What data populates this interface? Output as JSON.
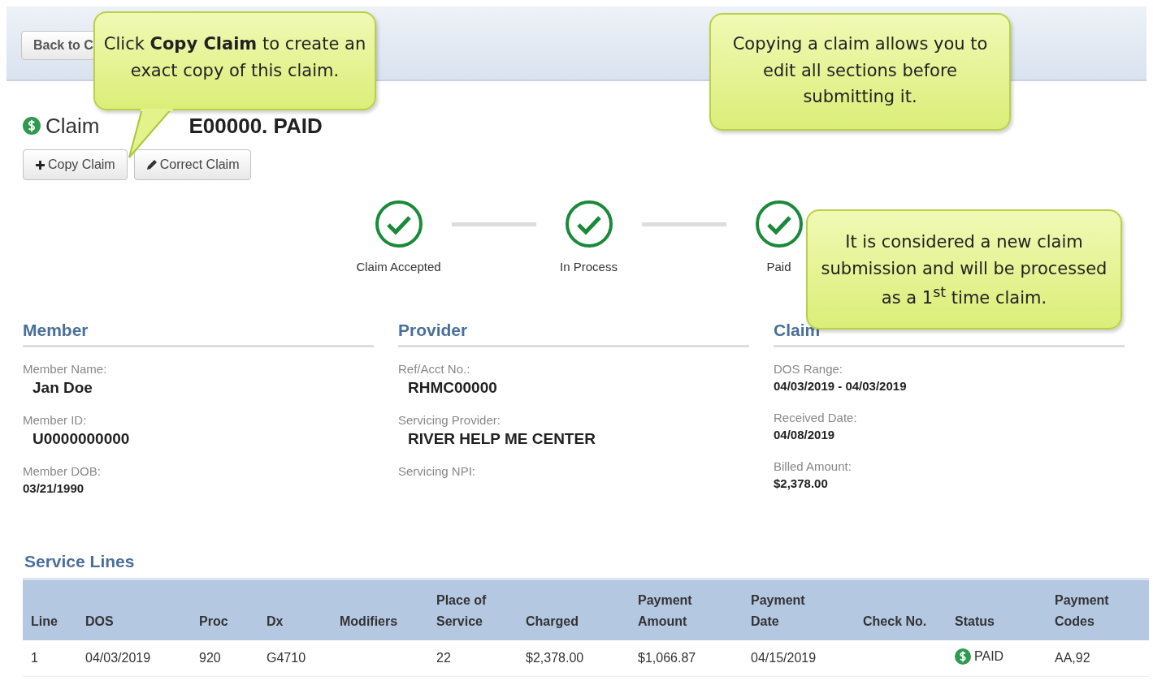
{
  "back_button": {
    "label": "Back to C"
  },
  "claim_title": {
    "word": "Claim",
    "number_end": "E00000. PAID"
  },
  "actions": [
    {
      "kind": "copy",
      "label": "Copy Claim"
    },
    {
      "kind": "correct",
      "label": "Correct Claim"
    }
  ],
  "progress_steps": [
    {
      "label": "Claim Accepted",
      "done": true
    },
    {
      "label": "In Process",
      "done": true
    },
    {
      "label": "Paid",
      "done": true
    }
  ],
  "sections": [
    {
      "title": "Member",
      "fields": [
        {
          "label": "Member Name:",
          "value": "Jan Doe",
          "emphasis": true
        },
        {
          "label": "Member ID:",
          "value": "U0000000000",
          "emphasis": true
        },
        {
          "label": "Member DOB:",
          "value": "03/21/1990",
          "emphasis": false
        }
      ]
    },
    {
      "title": "Provider",
      "fields": [
        {
          "label": "Ref/Acct No.:",
          "value": "RHMC00000",
          "emphasis": true
        },
        {
          "label": "Servicing Provider:",
          "value": "RIVER HELP ME CENTER",
          "emphasis": true
        },
        {
          "label": "Servicing NPI:"
        }
      ]
    },
    {
      "title": "Claim",
      "fields": [
        {
          "label": "DOS Range:",
          "value": "04/03/2019 - 04/03/2019",
          "emphasis": false
        },
        {
          "label": "Received Date:",
          "value": "04/08/2019",
          "emphasis": false
        },
        {
          "label": "Billed Amount:",
          "value": "$2,378.00",
          "emphasis": false
        }
      ]
    }
  ],
  "service_lines": {
    "title": "Service Lines",
    "columns": [
      {
        "heading": "Line"
      },
      {
        "heading": "DOS"
      },
      {
        "heading": "Proc"
      },
      {
        "heading": "Dx"
      },
      {
        "heading": "Modifiers"
      },
      {
        "heading": "Place of Service"
      },
      {
        "heading": "Charged"
      },
      {
        "heading": "Payment Amount"
      },
      {
        "heading": "Payment Date"
      },
      {
        "heading": "Check No."
      },
      {
        "heading": "Status"
      },
      {
        "heading": "Payment Codes"
      }
    ],
    "rows": [
      {
        "cells": [
          "1",
          "04/03/2019",
          "920",
          "G4710",
          null,
          "22",
          "$2,378.00",
          "$1,066.87",
          "04/15/2019",
          null,
          {
            "kind": "status",
            "text": "PAID"
          },
          "AA,92"
        ]
      }
    ]
  },
  "callouts": [
    {
      "kind": "pointer",
      "text": "Click **Copy Claim** to create an exact copy of this claim."
    },
    {
      "kind": "plain",
      "text": "Copying a claim allows you to edit all sections before submitting it."
    },
    {
      "kind": "plain",
      "text": "It is considered a new claim submission and will be processed as a 1$^{st}$ time claim."
    }
  ]
}
